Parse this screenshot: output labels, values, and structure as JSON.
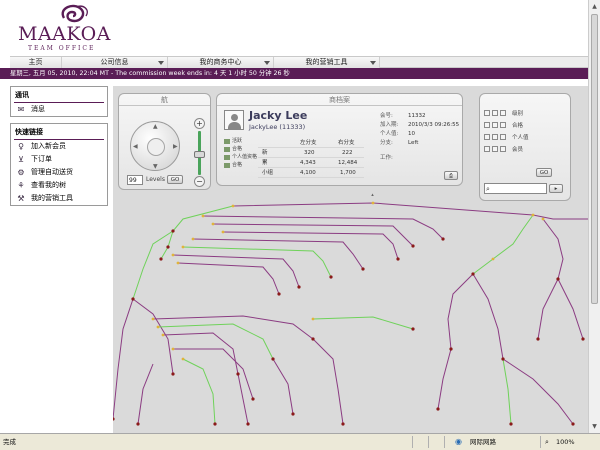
{
  "brand": {
    "name": "MAAKOA",
    "tagline": "TEAM OFFICE",
    "accent": "#5a1d56"
  },
  "nav": {
    "items": [
      {
        "label": "主页"
      },
      {
        "label": "公司信息"
      },
      {
        "label": "我的商务中心"
      },
      {
        "label": "我的营销工具"
      }
    ]
  },
  "status_strip": {
    "text": "星期三, 五月 05, 2010, 22:04 MT - The commission week ends in: 4 天 1 小时 50 分钟 26 秒"
  },
  "sidebar": {
    "notice_box": {
      "title": "通讯",
      "items": [
        {
          "label": "消息",
          "icon": "envelope-icon"
        }
      ]
    },
    "quick_links": {
      "title": "快速链接",
      "items": [
        {
          "label": "加入新会员",
          "icon": "add-member-icon"
        },
        {
          "label": "下订单",
          "icon": "cart-icon"
        },
        {
          "label": "管理自动送货",
          "icon": "gear-icon"
        },
        {
          "label": "查看我的树",
          "icon": "tree-icon"
        },
        {
          "label": "我的营销工具",
          "icon": "tools-icon"
        }
      ]
    }
  },
  "nav_panel": {
    "title": "航",
    "levels_value": "99",
    "levels_label": "Levels",
    "go_label": "GO",
    "zoom_in": "+",
    "zoom_out": "−"
  },
  "profile_panel": {
    "title": "商档案",
    "name": "Jacky Lee",
    "username": "JackyLee (11333)",
    "legend": [
      "活跃",
      "合格",
      "个人值资格",
      "合格"
    ],
    "volume_table": {
      "headers": [
        "",
        "左分支",
        "右分支"
      ],
      "rows": [
        {
          "label": "新",
          "left": "320",
          "right": "222"
        },
        {
          "label": "累",
          "left": "4,343",
          "right": "12,484"
        },
        {
          "label": "小组",
          "left": "4,100",
          "right": "1,700"
        }
      ]
    },
    "info": [
      {
        "label": "会号:",
        "value": "11332"
      },
      {
        "label": "加入期:",
        "value": "2010/3/3  09:26:55"
      },
      {
        "label": "个人值:",
        "value": "10"
      },
      {
        "label": "分支:",
        "value": "Left"
      },
      {
        "label": "工作:",
        "value": ""
      }
    ]
  },
  "filter_panel": {
    "labels": [
      "级别",
      "合格",
      "个人值",
      "会员"
    ],
    "search_placeholder": "",
    "go_label": "GO"
  },
  "browser_status": {
    "left_text": "完成",
    "zone_text": "网际网路",
    "zoom_text": "100%"
  }
}
